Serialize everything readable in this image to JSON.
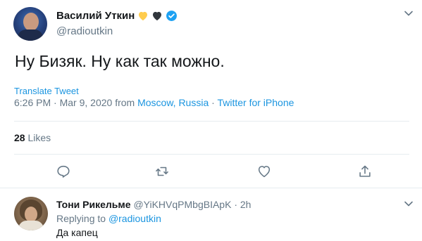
{
  "tweet": {
    "author_name": "Василий Уткин",
    "author_handle": "@radioutkin",
    "text": "Ну Бизяк. Ну как так можно.",
    "translate_label": "Translate Tweet",
    "time": "6:26 PM",
    "date": "Mar 9, 2020",
    "from_word": "from",
    "location": "Moscow, Russia",
    "source": "Twitter for iPhone",
    "likes_count": "28",
    "likes_label": "Likes",
    "badges": {
      "yellow_heart": "yellow-heart-icon",
      "black_heart": "black-heart-icon",
      "verified": "verified-badge-icon"
    }
  },
  "reply": {
    "author_name": "Тони Рикельме",
    "author_handle": "@YiKHVqPMbgBIApK",
    "time": "2h",
    "replying_to_label": "Replying to",
    "replying_to_handle": "@radioutkin",
    "text": "Да капец"
  },
  "colors": {
    "link": "#1b95e0",
    "muted": "#657786",
    "text": "#14171a",
    "verified": "#1da1f2",
    "yellow_heart": "#ffcc4d",
    "black_heart": "#31373d"
  }
}
